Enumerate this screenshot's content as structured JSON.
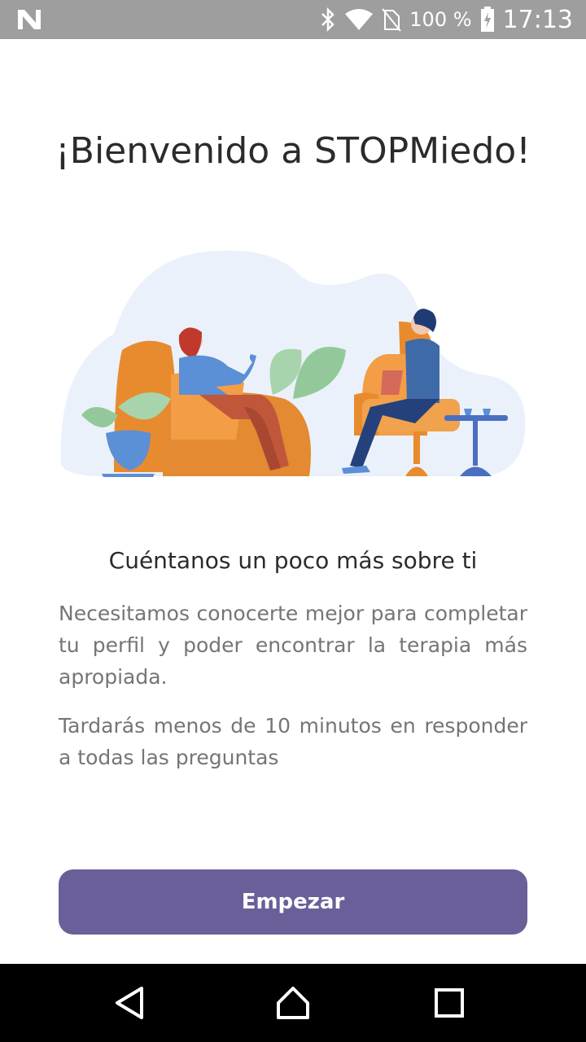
{
  "status_bar": {
    "battery_percent": "100 %",
    "time": "17:13",
    "icons": [
      "n-notification-icon",
      "bluetooth-icon",
      "wifi-icon",
      "no-sim-icon",
      "battery-charging-icon"
    ]
  },
  "welcome": {
    "title": "¡Bienvenido a STOPMiedo!",
    "illustration": "therapy-session-illustration"
  },
  "content": {
    "subtitle": "Cuéntanos un poco más sobre ti",
    "paragraph1": "Necesitamos conocerte mejor para completar tu perfil y poder encontrar la terapia más apropiada.",
    "paragraph2": "Tardarás menos de 10 minutos en responder a todas las preguntas"
  },
  "actions": {
    "start_label": "Empezar"
  },
  "nav_bar": {
    "icons": [
      "back-icon",
      "home-icon",
      "recent-apps-icon"
    ]
  },
  "colors": {
    "status_bar": "#9e9e9e",
    "primary_button": "#6b5f9a",
    "title_text": "#2b2b2b",
    "body_text": "#757575",
    "nav_bar": "#000000"
  }
}
